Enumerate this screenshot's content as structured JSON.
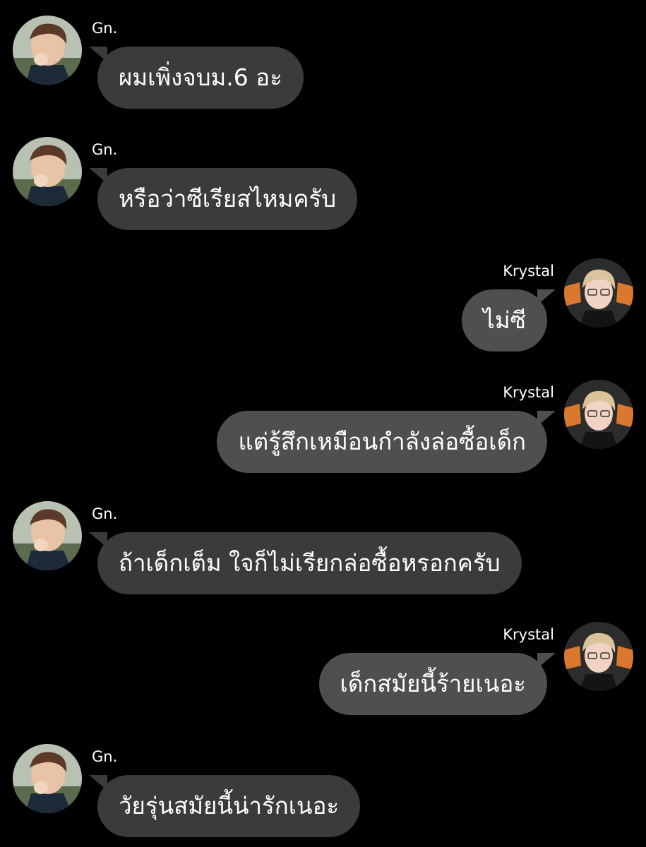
{
  "messages": [
    {
      "sender": "Gn.",
      "text": "ผมเพิ่งจบม.6 อะ"
    },
    {
      "sender": "Gn.",
      "text": "หรือว่าซีเรียสไหมครับ"
    },
    {
      "sender": "Krystal",
      "text": "ไม่ซี"
    },
    {
      "sender": "Krystal",
      "text": "แต่รู้สึกเหมือนกำลังล่อซื้อเด็ก"
    },
    {
      "sender": "Gn.",
      "text": "ถ้าเด็กเต็ม ใจก็ไม่เรียกล่อซื้อหรอกครับ"
    },
    {
      "sender": "Krystal",
      "text": "เด็กสมัยนี้ร้ายเนอะ"
    },
    {
      "sender": "Gn.",
      "text": "วัยรุ่นสมัยนี้น่ารักเนอะ"
    }
  ],
  "colors": {
    "background": "#000000",
    "gn_bubble": "#3b3b3b",
    "krystal_bubble": "#4f4f4f",
    "text": "#ffffff"
  },
  "icons": {
    "gn_avatar": "avatar-photo-gn",
    "krystal_avatar": "avatar-photo-krystal"
  }
}
